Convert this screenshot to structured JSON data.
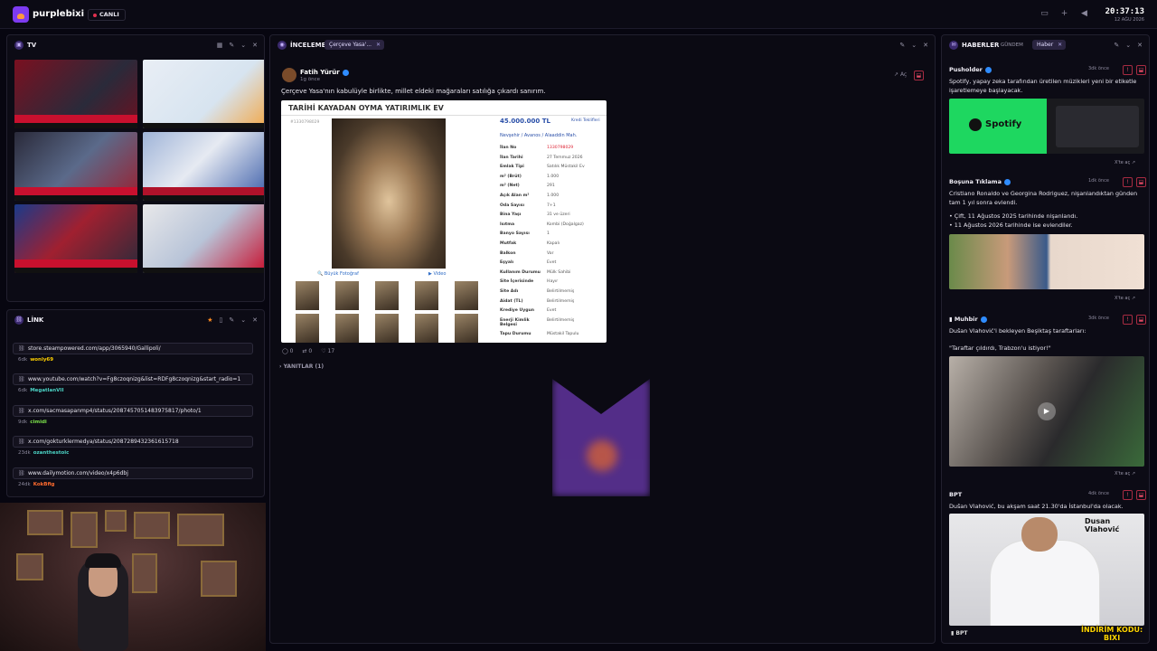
{
  "topbar": {
    "brand": "purplebixi",
    "live": "CANLI",
    "time": "20:37:13",
    "date": "12 AĞU 2026"
  },
  "tv": {
    "title": "TV",
    "thumbs": [
      {
        "caption": "ÖZEL: İÇİNDEKİ ULUSUN GELECEĞİ YAZIYORUZ"
      },
      {
        "caption": "Sigorta Sigortam.net'ten olsun!"
      },
      {
        "caption": "ÖZEL: OYLAMA İÇİN HİBRİT MODEL GELİŞTİRDİK"
      },
      {
        "caption": "KATARLI EŞLERİN CENAZESİNE KATILMADI"
      },
      {
        "caption": "ÖZEL: ERDOĞAN'IN TAŞIDIĞI MÜNİK YETKİ"
      },
      {
        "caption": "CANLI YAYIN"
      }
    ]
  },
  "link": {
    "title": "LİNK",
    "items": [
      {
        "url": "store.steampowered.com/app/3065940/Gallipoli/",
        "age": "6dk",
        "user": "wonly69",
        "color": "#ffd000"
      },
      {
        "url": "www.youtube.com/watch?v=Fg8czoqnizg&list=RDFg8czoqnizg&start_radio=1",
        "age": "6dk",
        "user": "MegatlanVII",
        "color": "#4bd2c4"
      },
      {
        "url": "x.com/sacmasapanmp4/status/2087457051483975817/photo/1",
        "age": "9dk",
        "user": "cimidi",
        "color": "#7be04a"
      },
      {
        "url": "x.com/gokturklermedya/status/2087289432361615718",
        "age": "23dk",
        "user": "ozanthestoic",
        "color": "#4bd2c4"
      },
      {
        "url": "www.dailymotion.com/video/x4p6dbj",
        "age": "24dk",
        "user": "KokBfig",
        "color": "#ff6b2e"
      }
    ]
  },
  "main": {
    "title": "İNCELEME",
    "tag": "Çerçeve Yasa'...",
    "author": "Fatih Yürür",
    "ago": "1g önce",
    "text": "Çerçeve Yasa'nın kabulüyle birlikte, millet eldeki mağaraları satılığa çıkardı sanırım.",
    "open": "Aç",
    "reactions": {
      "comments": "0",
      "reposts": "0",
      "likes": "17"
    },
    "replies": "YANITLAR (1)",
    "listing": {
      "title": "TARİHİ KAYADAN OYMA YATIRIMLIK EV",
      "id": "#1330798029",
      "price": "45.000.000 TL",
      "credit": "Kredi Teklifleri",
      "breadcrumb": "Nevşehir  /  Avanos  /  Alaaddin Mah.",
      "big_photo": "Büyük Fotoğraf",
      "video": "Video",
      "specs": [
        {
          "k": "İlan No",
          "v": "1330798029"
        },
        {
          "k": "İlan Tarihi",
          "v": "27 Temmuz 2026"
        },
        {
          "k": "Emlak Tipi",
          "v": "Satılık Müstakil Ev"
        },
        {
          "k": "m² (Brüt)",
          "v": "1.000"
        },
        {
          "k": "m² (Net)",
          "v": "291"
        },
        {
          "k": "Açık Alan m²",
          "v": "1.000"
        },
        {
          "k": "Oda Sayısı",
          "v": "7+1"
        },
        {
          "k": "Bina Yaşı",
          "v": "31 ve üzeri"
        },
        {
          "k": "Isıtma",
          "v": "Kombi (Doğalgaz)"
        },
        {
          "k": "Banyo Sayısı",
          "v": "1"
        },
        {
          "k": "Mutfak",
          "v": "Kapalı"
        },
        {
          "k": "Balkon",
          "v": "Var"
        },
        {
          "k": "Eşyalı",
          "v": "Evet"
        },
        {
          "k": "Kullanım Durumu",
          "v": "Mülk Sahibi"
        },
        {
          "k": "Site İçerisinde",
          "v": "Hayır"
        },
        {
          "k": "Site Adı",
          "v": "Belirtilmemiş"
        },
        {
          "k": "Aidat (TL)",
          "v": "Belirtilmemiş"
        },
        {
          "k": "Krediye Uygun",
          "v": "Evet"
        },
        {
          "k": "Enerji Kimlik Belgesi",
          "v": "Belirtilmemiş"
        },
        {
          "k": "Tapu Durumu",
          "v": "Müstakil Tapulu"
        }
      ]
    }
  },
  "news": {
    "title": "HABERLER",
    "tab": "GÜNDEM",
    "tag": "Haber",
    "items": [
      {
        "source": "Pusholder",
        "time": "3dk önce",
        "text": "Spotify, yapay zeka tarafından üretilen müzikleri yeni bir etiketle işaretlemeye başlayacak.",
        "open": "X'te aç",
        "img_label": "Spotify"
      },
      {
        "source": "Boşuna Tıklama",
        "time": "1dk önce",
        "text": "Cristiano Ronaldo ve Georgina Rodriguez, nişanlandıktan günden tam 1 yıl sonra evlendi.",
        "text2": "• Çift, 11 Ağustos 2025 tarihinde nişanlandı.",
        "text3": "• 11 Ağustos 2026 tarihinde ise evlendiler.",
        "open": "X'te aç"
      },
      {
        "source": "Muhbir",
        "time": "3dk önce",
        "text": "Dušan Vlahović'i bekleyen Beşiktaş taraftarları:",
        "text2": "\"Taraftar çıldırdı, Trabzon'u istiyor!\"",
        "open": "X'te aç"
      },
      {
        "source": "BPT",
        "time": "4dk önce",
        "text": "Dušan Vlahović, bu akşam saat 21.30'da İstanbul'da olacak.",
        "img_label": "Dusan Vlahović",
        "footer": "BPT"
      }
    ]
  },
  "ad": {
    "line1": "İNDİRİM KODU:",
    "line2": "BIXI"
  }
}
